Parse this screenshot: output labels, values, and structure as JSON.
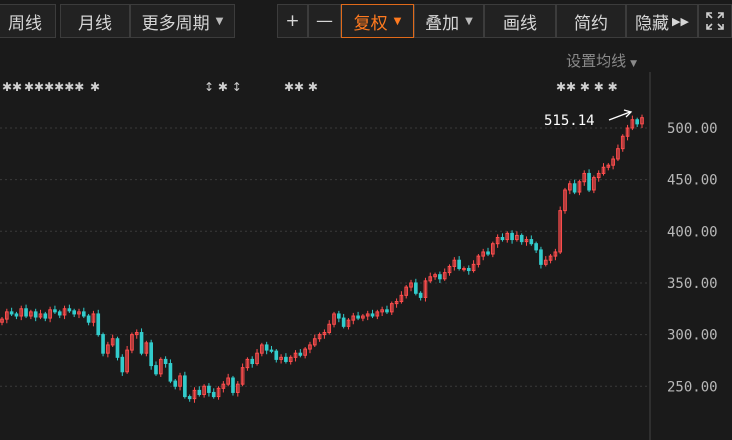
{
  "toolbar": {
    "weekly": "周线",
    "monthly": "月线",
    "more_periods": "更多周期",
    "zoom_in": "+",
    "zoom_out": "—",
    "adjust": "复权",
    "overlay": "叠加",
    "draw": "画线",
    "simple": "简约",
    "hide": "隐藏",
    "fullscreen_icon": "expand-icon"
  },
  "ma_settings": "设置均线",
  "colors": {
    "up": "#ff4d4d",
    "down": "#33cccc",
    "grid": "#3a3a3a",
    "accent": "#ff7a1f"
  },
  "chart_data": {
    "type": "candlestick",
    "ylim": [
      200,
      540
    ],
    "yticks": [
      250,
      300,
      350,
      400,
      450,
      500
    ],
    "ytick_labels": [
      "250.00",
      "300.00",
      "350.00",
      "400.00",
      "450.00",
      "500.00"
    ],
    "peak_label": "515.14",
    "peak_value": 515.14,
    "grid": true,
    "closes": [
      315,
      322,
      320,
      318,
      325,
      318,
      322,
      317,
      320,
      316,
      324,
      322,
      319,
      325,
      323,
      320,
      322,
      318,
      312,
      320,
      300,
      282,
      290,
      296,
      278,
      264,
      285,
      300,
      302,
      282,
      292,
      270,
      262,
      276,
      272,
      255,
      250,
      260,
      240,
      238,
      246,
      242,
      250,
      244,
      240,
      248,
      252,
      258,
      244,
      252,
      268,
      276,
      272,
      282,
      290,
      285,
      284,
      276,
      278,
      274,
      278,
      282,
      280,
      286,
      290,
      296,
      300,
      302,
      310,
      320,
      316,
      308,
      314,
      318,
      316,
      318,
      320,
      318,
      322,
      324,
      322,
      330,
      332,
      338,
      346,
      350,
      340,
      336,
      352,
      356,
      358,
      354,
      360,
      366,
      372,
      364,
      364,
      362,
      368,
      376,
      380,
      378,
      388,
      394,
      392,
      398,
      392,
      396,
      390,
      392,
      388,
      382,
      368,
      372,
      376,
      380,
      420,
      440,
      446,
      438,
      448,
      456,
      440,
      452,
      456,
      462,
      464,
      470,
      480,
      492,
      500,
      508,
      504,
      510
    ]
  }
}
